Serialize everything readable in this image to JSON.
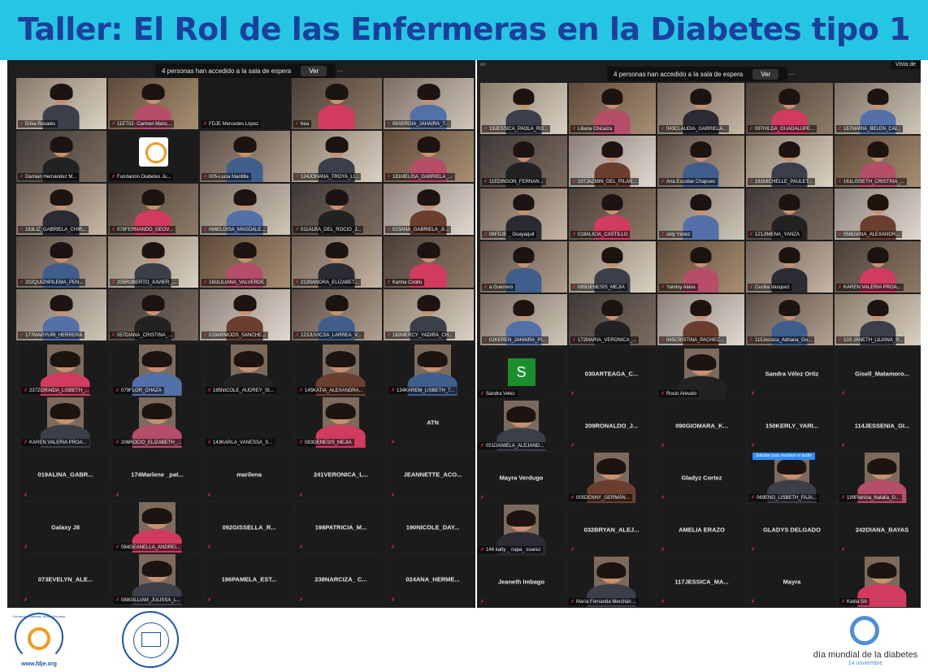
{
  "banner": {
    "title": "Taller: El Rol de las Enfermeras en la Diabetes tipo 1"
  },
  "left_window": {
    "notification": {
      "text": "4 personas han accedido a la sala de espera",
      "button": "Ver"
    },
    "video_tiles": [
      {
        "name": "Erika Rosales",
        "active": true
      },
      {
        "name": "11ET02- Carmen Manc..."
      },
      {
        "name": "FDJE Mercedes López",
        "blank": true
      },
      {
        "name": "bea"
      },
      {
        "name": "06SERGIA_JAHAIRA_T..."
      },
      {
        "name": "Damian Hernández M..."
      },
      {
        "name": "Fundación Diabetes Ju...",
        "logo": true
      },
      {
        "name": "005-Lucia Mantilla"
      },
      {
        "name": "124JOHANA_TROYA_LI..."
      },
      {
        "name": "181MELISA_GABRIELA_..."
      },
      {
        "name": "163LIZ_GABRIELA_CHIR..."
      },
      {
        "name": "078FERNANDO_GEOV..."
      },
      {
        "name": "066ELOISA_MAGDALE..."
      },
      {
        "name": "011ALBA_DEL_ROCIO_J..."
      },
      {
        "name": "023ANA_GABRIELA_JI..."
      },
      {
        "name": "202QUIZHPILEMA_PEN..."
      },
      {
        "name": "205ROBERTO_XAVIER_..."
      },
      {
        "name": "16OLILIANA_VALVERDE"
      },
      {
        "name": "213SANDRA_ELIZABET..."
      },
      {
        "name": "Karina Criollo"
      },
      {
        "name": "177MARYURI_HERRERA"
      },
      {
        "name": "057DIANA_CRISTINA_..."
      },
      {
        "name": "029ARMIJOS_SANCHE..."
      },
      {
        "name": "123JUVICSA_LARREA_V..."
      },
      {
        "name": "182MERCY_YADIRA_CH..."
      }
    ],
    "lower_tiles": [
      {
        "name": "237ZORAIDA_LISBETH_...",
        "photo": true
      },
      {
        "name": "079FLOR_CHAZA",
        "photo": true
      },
      {
        "name": "185NICOLE_AUDREY_SI...",
        "photo": true
      },
      {
        "name": "145KATIA_ALEXANDRA...",
        "photo": true
      },
      {
        "name": "134KAREM_LISBETH_T...",
        "photo": true
      },
      {
        "name": "KAREN VALERIA PROA...",
        "photo": true
      },
      {
        "name": "206ROCIO_ELIZABETH_...",
        "photo": true
      },
      {
        "name": "143KARLA_VANESSA_S...",
        "blank": true
      },
      {
        "name": "083GENESIS_MEJIA",
        "photo": true
      },
      {
        "big": "ATN"
      },
      {
        "big": "019ALINA_GABR..."
      },
      {
        "big": "174Marlene _pat..."
      },
      {
        "big": "marilena"
      },
      {
        "big": "241VERONICA_L..."
      },
      {
        "big": "JEANNETTE_ACO..."
      },
      {
        "big": "Galaxy J8"
      },
      {
        "name": "084GEANELLA_ANDREI...",
        "photo": true
      },
      {
        "big": "092GISSELLA_R..."
      },
      {
        "big": "198PATRICIA_M..."
      },
      {
        "big": "190NICOLE_DAY..."
      },
      {
        "big": "073EVELYN_ALE..."
      },
      {
        "name": "088GILLIAM_JULISSA_L...",
        "photo": true
      },
      {
        "big": "196PAMELA_EST..."
      },
      {
        "big": "238NARCIZA_ C..."
      },
      {
        "big": "024ANA_HERME..."
      }
    ]
  },
  "right_window": {
    "notification": {
      "text": "4 personas han accedido a la sala de espera",
      "button": "Ver"
    },
    "top_button": "Vista de",
    "top_mark": "on",
    "video_tiles": [
      {
        "name": "19JESSICA_PAOLA_RO..."
      },
      {
        "name": "Liliana Chicaiza"
      },
      {
        "name": "043CLAUDIA_GABRIELA..."
      },
      {
        "name": "097HILDA_GUADALUPE..."
      },
      {
        "name": "167MARIA_BELEN_CAI..."
      },
      {
        "name": "11EDINSON_FERNAN..."
      },
      {
        "name": "107JAZMIN_DEL_PILAR..."
      },
      {
        "name": "Ana Escobar Chapues"
      },
      {
        "name": "181MICHELLE_PAULET..."
      },
      {
        "name": "161LISSETH_CRISTINA_..."
      },
      {
        "name": "06FDJE _ Guayaquil"
      },
      {
        "name": "018ALICIA_CASTILLO"
      },
      {
        "name": "cely Yánez"
      },
      {
        "name": "121JIMENA_YANZA"
      },
      {
        "name": "056DIANA_ALEXANDR..."
      },
      {
        "name": "a Guerrero"
      },
      {
        "name": "085GENESIS_MEJIA"
      },
      {
        "name": "Yamisy Alava"
      },
      {
        "name": "Cecilia Vasquez"
      },
      {
        "name": "KAREN VALERIA PROA..."
      },
      {
        "name": "02KEREN_JAHAIRA_PI..."
      },
      {
        "name": "172MARIA_VERONICA_..."
      },
      {
        "name": "045CRISTINA_PACHEC..."
      },
      {
        "name": "115Jessica_Adriana_Go..."
      },
      {
        "name": "103 JANETH_LILIANA_P..."
      }
    ],
    "lower_tiles": [
      {
        "name": "Sandra Velez",
        "avatar": "S"
      },
      {
        "big": "030ARTEAGA_C..."
      },
      {
        "name": "Rocio Arevalo",
        "photo": true
      },
      {
        "big": "Sandra Vélez Ortiz"
      },
      {
        "big": "Gisell_Matamoro..."
      },
      {
        "name": "051DANIELA_ALEJAND...",
        "photo": true
      },
      {
        "big": "209RONALDO_J..."
      },
      {
        "big": "090GIOMARA_K..."
      },
      {
        "big": "150KERLY_YARI..."
      },
      {
        "big": "114JESSENIA_GI..."
      },
      {
        "big": "Mayra Verdugo"
      },
      {
        "name": "005DENNY_GERMÁN...",
        "photo": true
      },
      {
        "big": "Gladyz Cortez"
      },
      {
        "name": "069ENG_LISBETH_FAJA...",
        "photo": true,
        "tooltip": "Solicitar para reactivar el audio"
      },
      {
        "name": "199Patricia_Natalia_G...",
        "photo": true
      },
      {
        "name": "146 katty _ napa_ suarez",
        "photo": true
      },
      {
        "big": "032BRYAN_ALEJ..."
      },
      {
        "big": "AMELIA ERAZO"
      },
      {
        "big": "GLADYS DELGADO"
      },
      {
        "big": "242DIANA_BAYAS"
      },
      {
        "big": "Jeaneth Imbago"
      },
      {
        "name": "María Fernanda Merchán ...",
        "photo": true
      },
      {
        "big": "117JESSICA_MA..."
      },
      {
        "big": "Mayra"
      },
      {
        "name": "Katita SA",
        "photo": true
      }
    ]
  },
  "footer": {
    "logo_left_text": "Fundación Diabetes Juvenil Ecuador",
    "logo_left_url": "www.fdje.org",
    "logo_right_text": "día mundial de la diabetes",
    "logo_right_date": "14 noviembre"
  }
}
